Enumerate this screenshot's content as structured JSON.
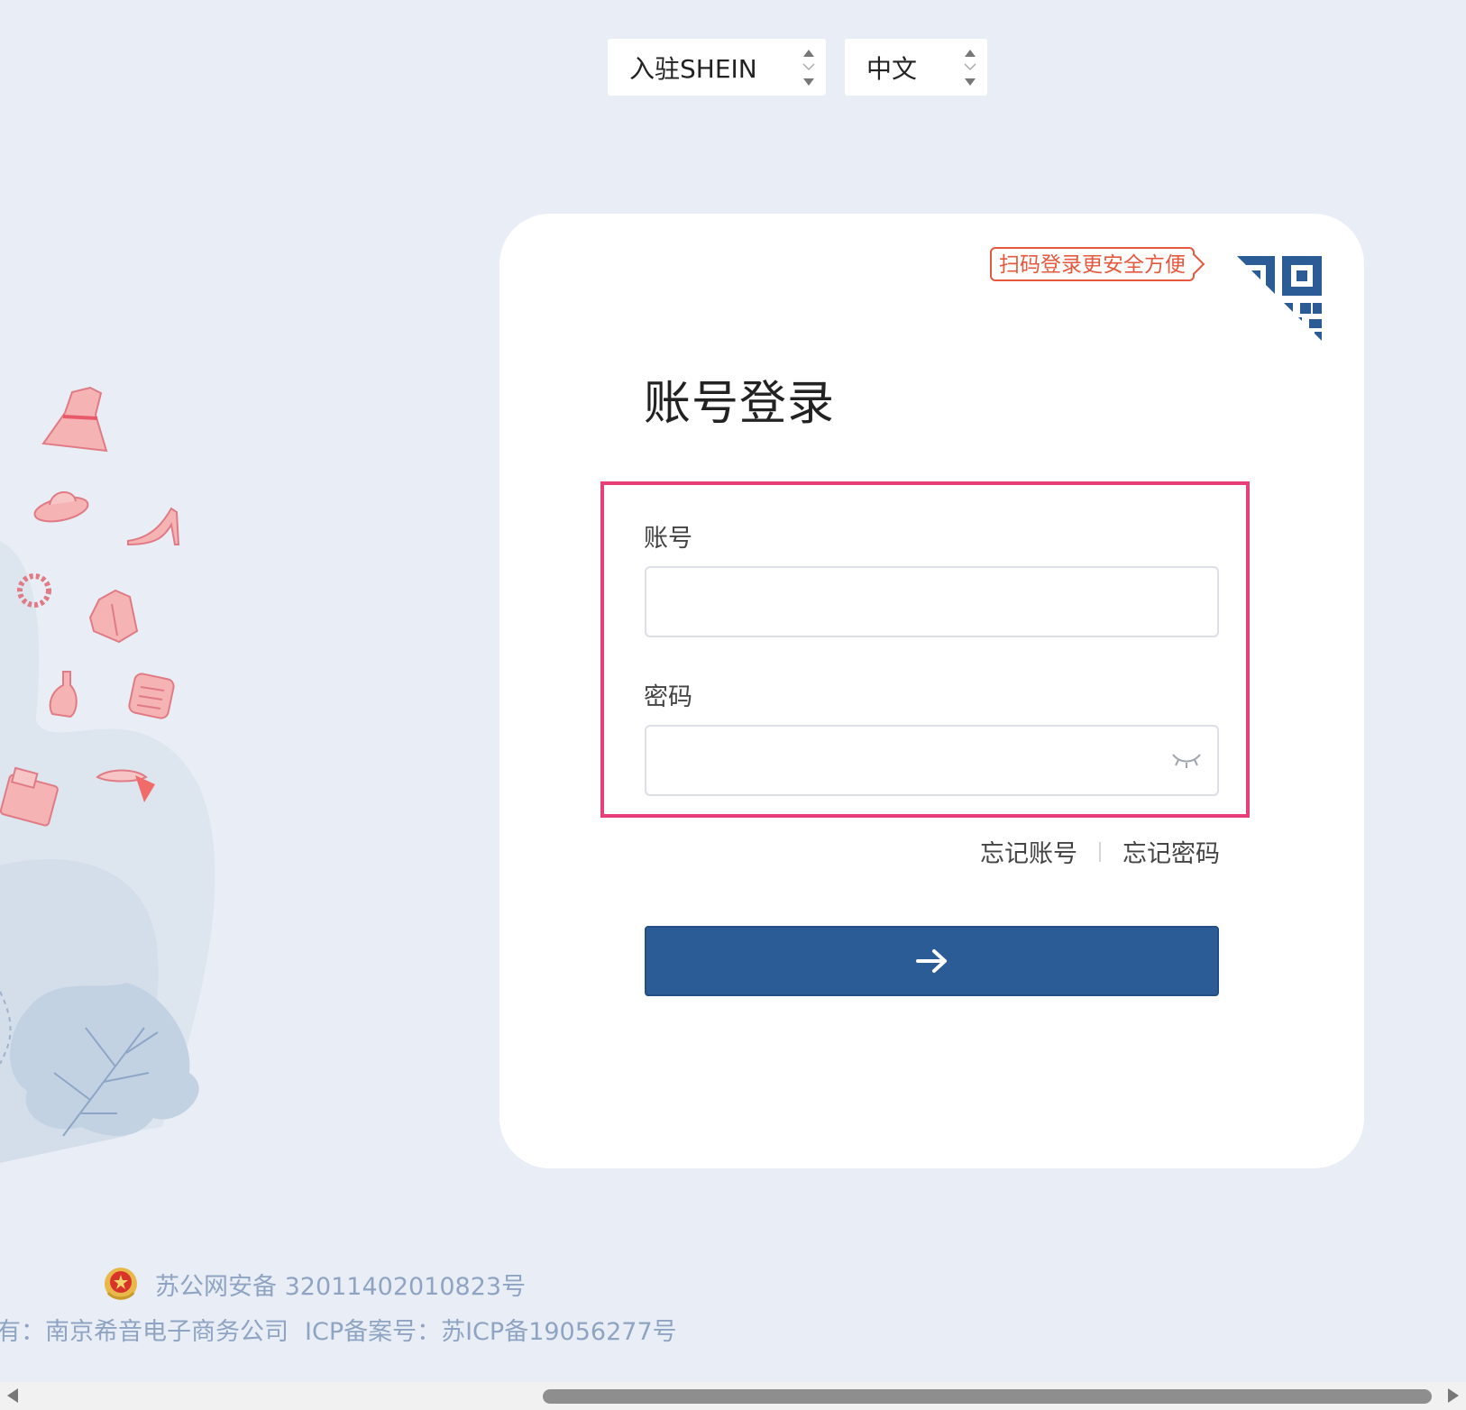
{
  "top": {
    "join_select": "入驻SHEIN",
    "language_select": "中文"
  },
  "login": {
    "qr_tip": "扫码登录更安全方便",
    "title": "账号登录",
    "account_label": "账号",
    "account_value": "",
    "password_label": "密码",
    "password_value": "",
    "forgot_account": "忘记账号",
    "forgot_password": "忘记密码",
    "submit_icon": "arrow-right-icon"
  },
  "footer": {
    "police_record": "苏公网安备 32011402010823号",
    "company": "有：南京希音电子商务公司",
    "icp": "ICP备案号：苏ICP备19056277号"
  },
  "colors": {
    "background": "#e9eef6",
    "primary": "#2c5c96",
    "highlight": "#e83e7a",
    "qr_tip": "#e5583d",
    "footer_text": "#8fa4c2"
  }
}
